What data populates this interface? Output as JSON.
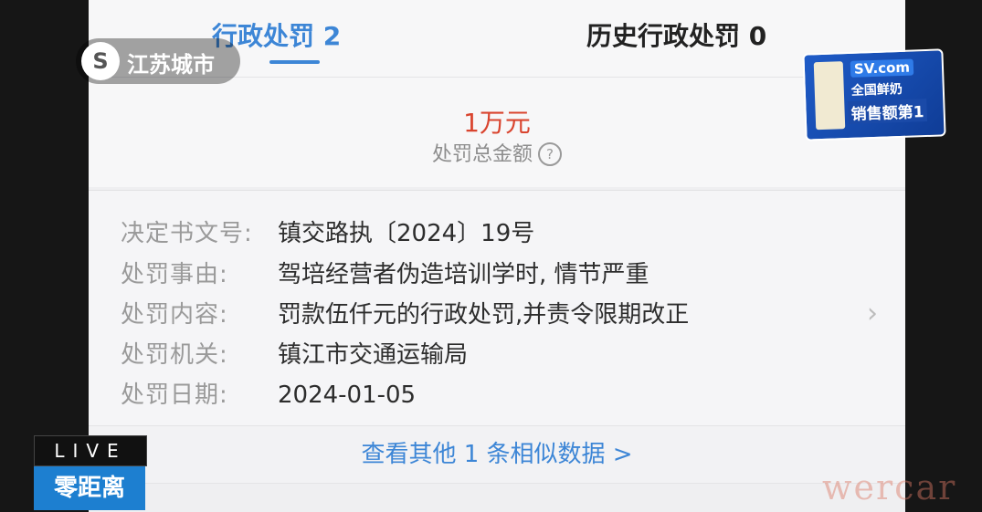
{
  "tabs": [
    {
      "label": "行政处罚 2",
      "active": true
    },
    {
      "label": "历史行政处罚 0",
      "active": false
    }
  ],
  "summary": {
    "amount": "1万元",
    "amount_label": "处罚总金额",
    "help_icon": "?"
  },
  "details": [
    {
      "label": "决定书文号:",
      "value": "镇交路执〔2024〕19号"
    },
    {
      "label": "处罚事由:",
      "value": "驾培经营者伪造培训学时, 情节严重"
    },
    {
      "label": "处罚内容:",
      "value": "罚款伍仟元的行政处罚,并责令限期改正"
    },
    {
      "label": "处罚机关:",
      "value": "镇江市交通运输局"
    },
    {
      "label": "处罚日期:",
      "value": "2024-01-05"
    }
  ],
  "more_link": "查看其他 1 条相似数据 >",
  "overlay": {
    "channel_logo": "江苏城市",
    "live_label": "LIVE",
    "program_name": "零距离",
    "ad": {
      "brand": "SV.com",
      "line1": "全国鲜奶",
      "line2": "销售额第1"
    },
    "watermark": "wercar"
  },
  "colors": {
    "accent": "#3d86d6",
    "amount": "#d9442e"
  }
}
